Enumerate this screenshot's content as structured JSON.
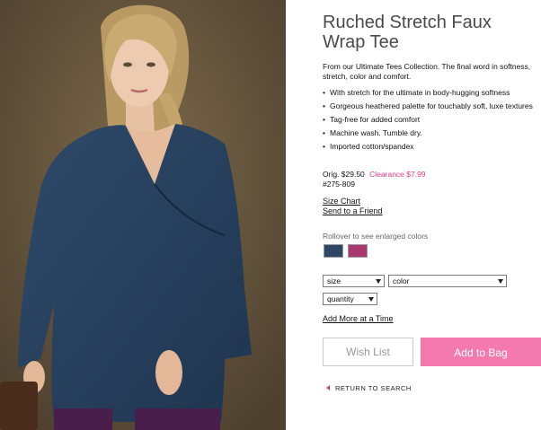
{
  "product": {
    "title_line1": "Ruched Stretch Faux",
    "title_line2": "Wrap Tee",
    "intro": "From our Ultimate Tees Collection. The final word in softness, stretch, color and comfort.",
    "features": [
      "With stretch for the ultimate in body-hugging softness",
      "Gorgeous heathered palette for touchably soft, luxe textures",
      "Tag-free for added comfort",
      "Machine wash. Tumble dry.",
      "Imported cotton/spandex"
    ],
    "orig_price": "Orig. $29.50",
    "clearance_price": "Clearance $7.99",
    "sku": "#275-809"
  },
  "links": {
    "size_chart": "Size Chart",
    "send_friend": "Send to a Friend",
    "add_more": "Add More at a Time"
  },
  "colors": {
    "rollover_text": "Rollover to see enlarged colors",
    "swatches": [
      {
        "name": "navy",
        "hex": "#2c4663"
      },
      {
        "name": "berry",
        "hex": "#a8386e"
      }
    ]
  },
  "selects": {
    "size": "size",
    "color": "color",
    "quantity": "quantity"
  },
  "buttons": {
    "wish_list": "Wish List",
    "add_to_bag": "Add to Bag",
    "return": "RETURN TO SEARCH"
  },
  "theme": {
    "accent": "#e23a86",
    "bag_button": "#f47aae"
  }
}
